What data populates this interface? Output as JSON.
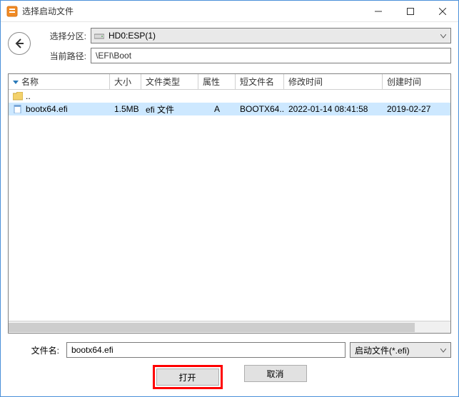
{
  "window": {
    "title": "选择启动文件"
  },
  "header": {
    "partition_label": "选择分区:",
    "partition_value": "HD0:ESP(1)",
    "path_label": "当前路径:",
    "path_value": "\\EFI\\Boot"
  },
  "columns": {
    "name": "名称",
    "size": "大小",
    "type": "文件类型",
    "attr": "属性",
    "short": "短文件名",
    "mod": "修改时间",
    "create": "创建时间"
  },
  "rows": {
    "up": {
      "name": ".."
    },
    "file1": {
      "name": "bootx64.efi",
      "size": "1.5MB",
      "type": "efi 文件",
      "attr": "A",
      "short": "BOOTX64....",
      "mod": "2022-01-14 08:41:58",
      "create": "2019-02-27"
    }
  },
  "footer": {
    "filename_label": "文件名:",
    "filename_value": "bootx64.efi",
    "filter_value": "启动文件(*.efi)",
    "open_label": "打开",
    "cancel_label": "取消"
  }
}
